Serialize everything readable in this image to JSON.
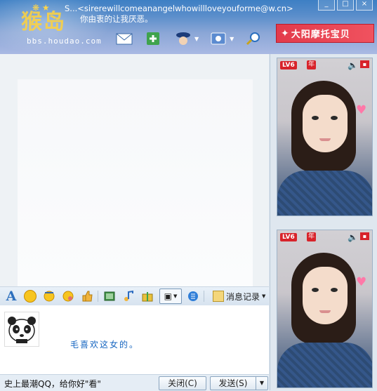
{
  "header": {
    "logo_text": "猴岛",
    "logo_url": "bbs.houdao.com",
    "contact_name": "S...<sirerewillcomeanangelwhowillloveyouforme@w.cn>",
    "contact_signature": "你由衷的让我厌恶。",
    "window_buttons": [
      "_",
      "□",
      "×"
    ]
  },
  "toolbar": {
    "icons": [
      "video-call-icon",
      "email-icon",
      "add-contact-icon",
      "police-icon",
      "settings-icon",
      "search-icon"
    ]
  },
  "ad_banner": {
    "text": "大阳摩托宝贝"
  },
  "format_toolbar": {
    "font_label": "A",
    "history_label": "消息记录"
  },
  "input": {
    "message": "毛喜欢这女的。"
  },
  "bottom_bar": {
    "ad_text": "史上最潮QQ，给你好\"看\"",
    "close_label": "关闭(C)",
    "send_label": "发送(S)"
  },
  "photos": [
    {
      "level": "LV6",
      "year": "年"
    },
    {
      "level": "LV6",
      "year": "年"
    }
  ],
  "colors": {
    "title_gradient_top": "#3d7fc4",
    "banner_red": "#e33a4b",
    "message_blue": "#1565c0"
  }
}
